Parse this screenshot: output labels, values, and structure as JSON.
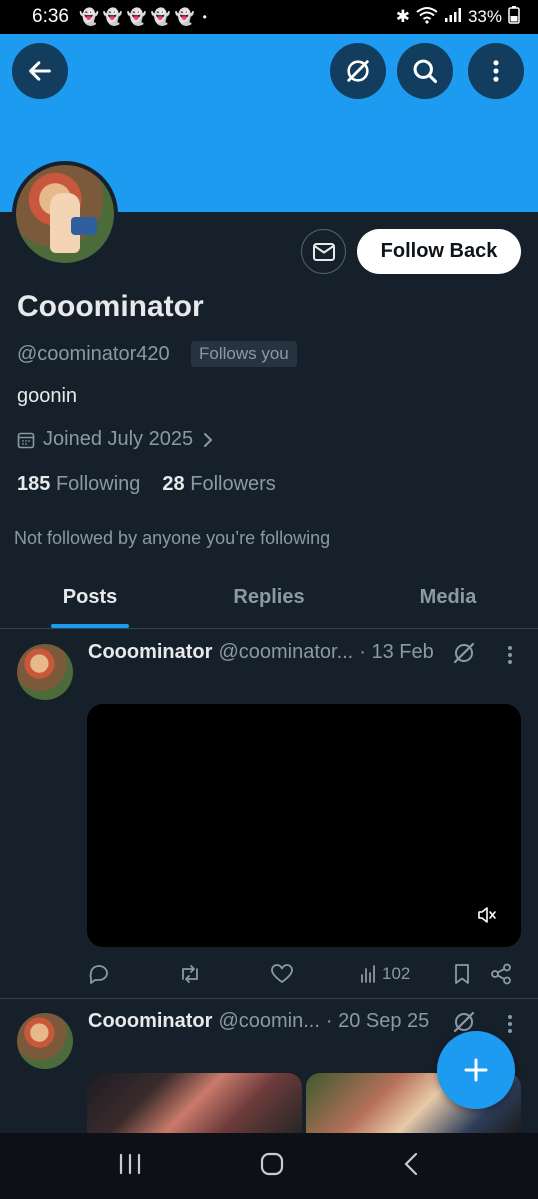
{
  "status_bar": {
    "time": "6:36",
    "notification_icons": [
      "snapchat-icon",
      "snapchat-icon",
      "snapchat-icon",
      "snapchat-icon",
      "snapchat-icon"
    ],
    "dot": "•",
    "battery": "33%"
  },
  "profile": {
    "display_name": "Cooominator",
    "handle": "@coominator420",
    "follows_you": "Follows you",
    "bio": "goonin",
    "joined": "Joined July 2025",
    "following_count": "185",
    "following_label": "Following",
    "followers_count": "28",
    "followers_label": "Followers",
    "not_followed": "Not followed by anyone you’re following",
    "follow_button": "Follow Back"
  },
  "tabs": [
    {
      "label": "Posts",
      "active": true
    },
    {
      "label": "Replies",
      "active": false
    },
    {
      "label": "Media",
      "active": false
    }
  ],
  "posts": [
    {
      "name": "Cooominator",
      "handle": "@coominator...",
      "date": "· 13 Feb",
      "views": "102"
    },
    {
      "name": "Cooominator",
      "handle": "@coomin...",
      "date": "· 20 Sep 25"
    }
  ],
  "colors": {
    "accent": "#1d9bf0",
    "background": "#15202b",
    "muted_text": "#8b98a5"
  }
}
